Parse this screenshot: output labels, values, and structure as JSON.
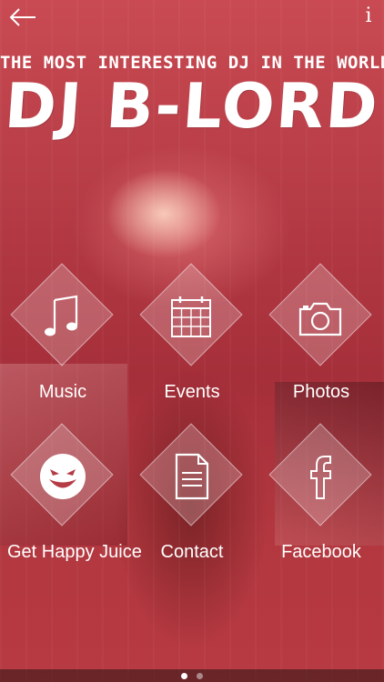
{
  "header": {
    "back_icon": "back-arrow-icon",
    "info_label": "i"
  },
  "hero": {
    "tagline": "THE MOST INTERESTING DJ IN THE WORLD",
    "title": "DJ B-LORD"
  },
  "menu": {
    "items": [
      {
        "label": "Music",
        "icon": "music-note-icon"
      },
      {
        "label": "Events",
        "icon": "calendar-icon"
      },
      {
        "label": "Photos",
        "icon": "camera-icon"
      },
      {
        "label": "Get Happy Juice",
        "icon": "smiley-icon"
      },
      {
        "label": "Contact",
        "icon": "document-icon"
      },
      {
        "label": "Facebook",
        "icon": "facebook-icon"
      }
    ]
  },
  "pager": {
    "pages": 2,
    "active_page": 1
  },
  "colors": {
    "overlay": "#b53b45",
    "text": "#ffffff"
  }
}
